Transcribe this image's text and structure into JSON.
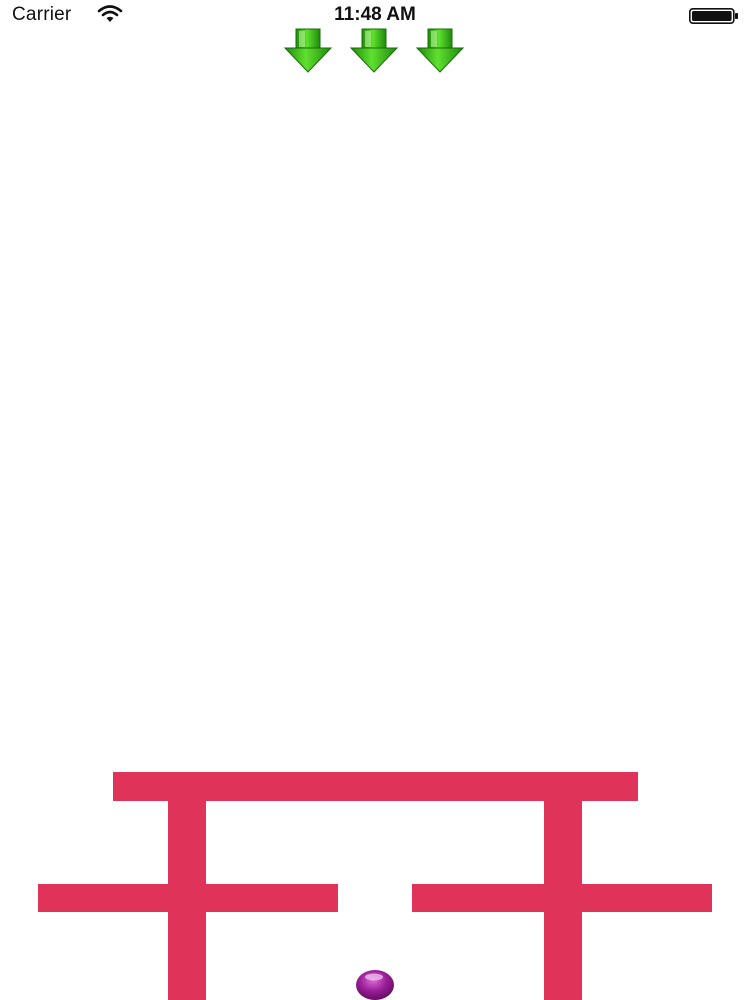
{
  "status_bar": {
    "carrier": "Carrier",
    "time": "11:48 AM",
    "icons": [
      "wifi-icon",
      "battery-icon"
    ]
  },
  "game": {
    "lives_remaining": 3,
    "life_icon": "green-down-arrow-icon",
    "obstacle_color": "#e0335a",
    "ball_color": "#8e1a8c",
    "arrow_color": "#3ec41a"
  }
}
